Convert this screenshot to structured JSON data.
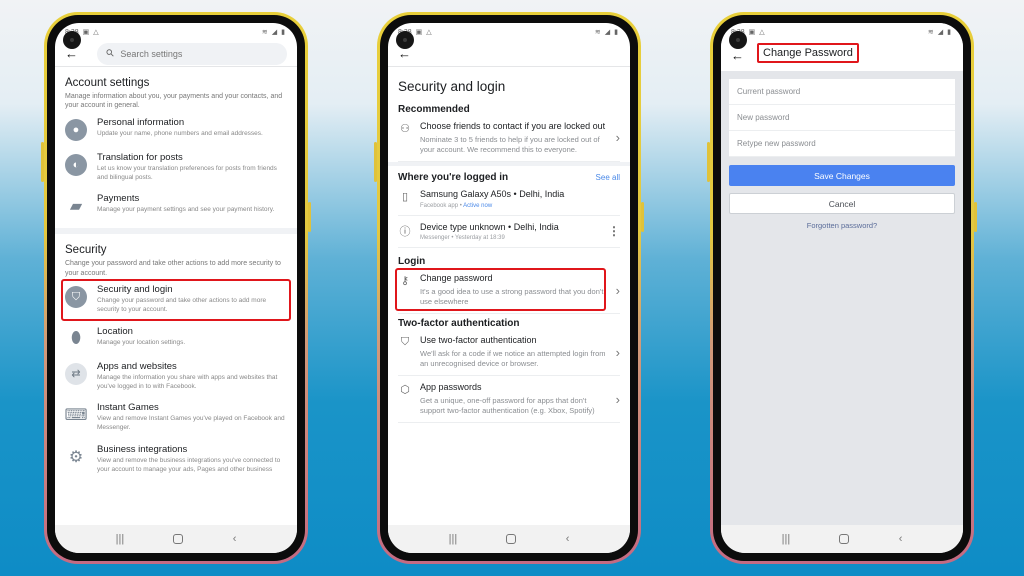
{
  "status_bar": {
    "time": "8:38",
    "left_icons": [
      "image-icon",
      "drive-icon"
    ],
    "right_icons": [
      "wifi-icon",
      "volte-icon",
      "signal-icon",
      "signal-icon",
      "battery-icon"
    ]
  },
  "nav_bar": {
    "recents": "|||",
    "back": "‹"
  },
  "screen1": {
    "search_placeholder": "Search settings",
    "account": {
      "title": "Account settings",
      "description": "Manage information about you, your payments and your contacts, and your account in general.",
      "items": [
        {
          "icon": "person-icon",
          "title": "Personal information",
          "desc": "Update your name, phone numbers and email addresses."
        },
        {
          "icon": "globe-icon",
          "title": "Translation for posts",
          "desc": "Let us know your translation preferences for posts from friends and bilingual posts."
        },
        {
          "icon": "credit-card-icon",
          "title": "Payments",
          "desc": "Manage your payment settings and see your payment history."
        }
      ]
    },
    "security": {
      "title": "Security",
      "description": "Change your password and take other actions to add more security to your account.",
      "items": [
        {
          "icon": "shield-icon",
          "title": "Security and login",
          "desc": "Change your password and take other actions to add more security to your account.",
          "highlighted": true
        },
        {
          "icon": "location-pin-icon",
          "title": "Location",
          "desc": "Manage your location settings."
        },
        {
          "icon": "swap-arrows-icon",
          "title": "Apps and websites",
          "desc": "Manage the information you share with apps and websites that you've logged in to with Facebook."
        },
        {
          "icon": "gamepad-icon",
          "title": "Instant Games",
          "desc": "View and remove Instant Games you've played on Facebook and Messenger."
        },
        {
          "icon": "business-gear-icon",
          "title": "Business integrations",
          "desc": "View and remove the business integrations you've connected to your account to manage your ads, Pages and other business"
        }
      ]
    }
  },
  "screen2": {
    "title": "Security and login",
    "recommended": {
      "heading": "Recommended",
      "item": {
        "title": "Choose friends to contact if you are locked out",
        "desc": "Nominate 3 to 5 friends to help if you are locked out of your account. We recommend this to everyone."
      }
    },
    "logged_in": {
      "heading": "Where you're logged in",
      "see_all": "See all",
      "devices": [
        {
          "name": "Samsung Galaxy A50s • Delhi, India",
          "app": "Facebook app",
          "status": "Active now"
        },
        {
          "name": "Device type unknown • Delhi, India",
          "app": "Messenger",
          "status": "Yesterday at 18:39"
        }
      ]
    },
    "login": {
      "heading": "Login",
      "item": {
        "title": "Change password",
        "desc": "It's a good idea to use a strong password that you don't use elsewhere",
        "highlighted": true
      }
    },
    "two_factor": {
      "heading": "Two-factor authentication",
      "items": [
        {
          "title": "Use two-factor authentication",
          "desc": "We'll ask for a code if we notice an attempted login from an unrecognised device or browser."
        },
        {
          "title": "App passwords",
          "desc": "Get a unique, one-off password for apps that don't support two-factor authentication (e.g. Xbox, Spotify)"
        }
      ]
    }
  },
  "screen3": {
    "title": "Change Password",
    "fields": {
      "current": {
        "placeholder": "Current password",
        "value": ""
      },
      "new": {
        "placeholder": "New password",
        "value": ""
      },
      "retype": {
        "placeholder": "Retype new password",
        "value": ""
      }
    },
    "save_label": "Save Changes",
    "cancel_label": "Cancel",
    "forgot_label": "Forgotten password?"
  },
  "colors": {
    "highlight": "#e0161b",
    "primary_button": "#4a82f0",
    "link": "#4a89e8"
  }
}
